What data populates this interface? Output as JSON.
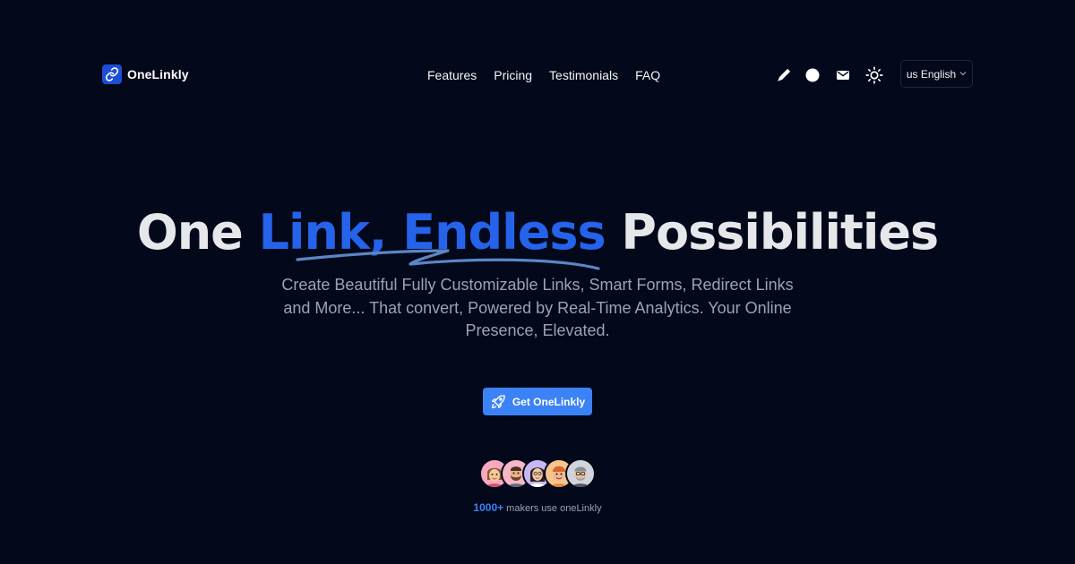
{
  "brand": {
    "name": "OneLinkly",
    "logo_icon": "link-icon",
    "logo_color": "#1d4ed8"
  },
  "nav": {
    "links": [
      "Features",
      "Pricing",
      "Testimonials",
      "FAQ"
    ],
    "icons": [
      "pen-icon",
      "circle-icon",
      "mail-icon",
      "sun-icon"
    ],
    "language": {
      "label": "us English",
      "icon": "chevron-down-icon"
    }
  },
  "hero": {
    "title_start": "One ",
    "title_accent": "Link, Endless",
    "title_end": " Possibilities",
    "subtitle": "Create Beautiful Fully Customizable Links, Smart Forms, Redirect Links and More... That convert, Powered by Real-Time Analytics. Your Online Presence, Elevated.",
    "cta_label": "Get OneLinkly",
    "cta_icon": "rocket-icon"
  },
  "social_proof": {
    "count": "1000+",
    "text": " makers use oneLinkly",
    "avatars": [
      "avatar-1",
      "avatar-2",
      "avatar-3",
      "avatar-4",
      "avatar-5"
    ]
  },
  "colors": {
    "background": "#03081a",
    "accent": "#2563eb",
    "button": "#3b82f6",
    "text": "#e5e7eb",
    "muted": "#9ca3af"
  }
}
